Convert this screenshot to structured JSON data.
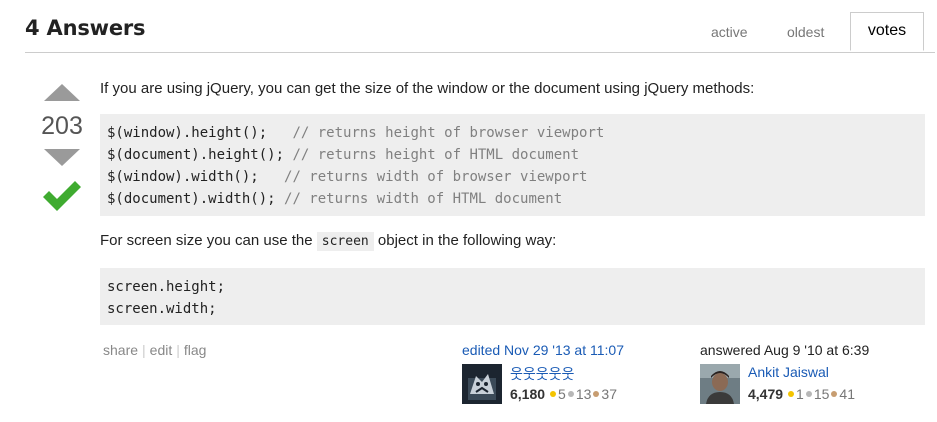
{
  "header": {
    "title": "4 Answers",
    "tabs": [
      {
        "label": "active"
      },
      {
        "label": "oldest"
      },
      {
        "label": "votes",
        "selected": true
      }
    ]
  },
  "vote": {
    "count": "203",
    "up_icon": "up-arrow-icon",
    "down_icon": "down-arrow-icon",
    "accepted_icon": "checkmark-icon",
    "accepted_color": "#3fab30"
  },
  "post": {
    "intro": "If you are using jQuery, you can get the size of the window or the document using jQuery methods:",
    "code1": [
      {
        "code": "$(window).height();   ",
        "comment": "// returns height of browser viewport"
      },
      {
        "code": "$(document).height(); ",
        "comment": "// returns height of HTML document"
      },
      {
        "code": "$(window).width();   ",
        "comment": "// returns width of browser viewport"
      },
      {
        "code": "$(document).width(); ",
        "comment": "// returns width of HTML document"
      }
    ],
    "p2_before": "For screen size you can use the ",
    "p2_code": "screen",
    "p2_after": " object in the following way:",
    "code2": [
      "screen.height;",
      "screen.width;"
    ]
  },
  "menu": {
    "share": "share",
    "edit": "edit",
    "flag": "flag",
    "sep": "|"
  },
  "edited": {
    "action": "edited Nov 29 '13 at 11:07",
    "user": "웃웃웃웃웃",
    "reputation": "6,180",
    "gold": "5",
    "silver": "13",
    "bronze": "37"
  },
  "answered": {
    "action": "answered Aug 9 '10 at 6:39",
    "user": "Ankit Jaiswal",
    "reputation": "4,479",
    "gold": "1",
    "silver": "15",
    "bronze": "41"
  },
  "colors": {
    "link": "#1a5bb5",
    "gold": "#f4c400",
    "silver": "#b7b7b7",
    "bronze": "#c79d71"
  }
}
